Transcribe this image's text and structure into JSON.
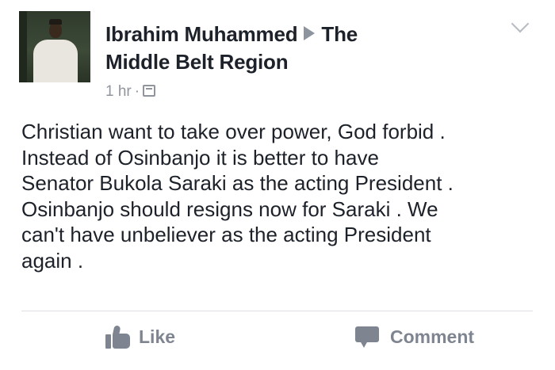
{
  "post": {
    "author": "Ibrahim Muhammed",
    "target_group_line1": "The",
    "target_group_line2": "Middle Belt Region",
    "time": "1 hr",
    "separator": "·",
    "body_lines": [
      "Christian want to take over power, God forbid .",
      "Instead of Osinbanjo it is better to have",
      "Senator Bukola Saraki as the acting President .",
      "Osinbanjo should resigns now for Saraki . We",
      "can't have unbeliever as the acting President",
      "again ."
    ]
  },
  "actions": {
    "like_label": "Like",
    "comment_label": "Comment"
  },
  "icons": {
    "avatar": "profile-photo",
    "arrow": "right-triangle-icon",
    "audience": "group-audience-icon",
    "menu": "chevron-down-icon",
    "like": "thumbs-up-icon",
    "comment": "comment-bubble-icon"
  },
  "colors": {
    "text": "#1d2129",
    "muted": "#90949c",
    "action": "#7f8590",
    "divider": "#dddfe2"
  }
}
